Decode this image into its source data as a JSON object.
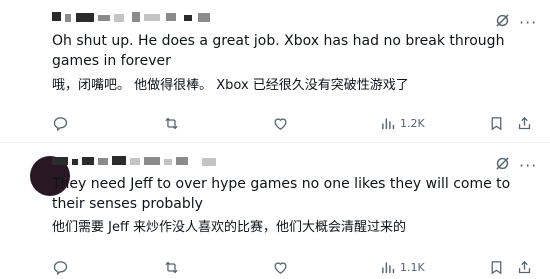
{
  "tweets": [
    {
      "text": "Oh shut up.  He does a great job.  Xbox has had no break through games in forever",
      "translation": "哦，闭嘴吧。 他做得很棒。 Xbox 已经很久没有突破性游戏了",
      "views": "1.2K"
    },
    {
      "text": "They need Jeff to over hype games no one likes they will come to their senses probably",
      "translation": "他们需要 Jeff 来炒作没人喜欢的比赛，他们大概会清醒过来的",
      "views": "1.1K"
    }
  ],
  "icons": {
    "grok": "grok-icon",
    "more": "more-icon",
    "reply": "reply-icon",
    "retweet": "retweet-icon",
    "like": "like-icon",
    "views": "views-icon",
    "bookmark": "bookmark-icon",
    "share": "share-icon"
  },
  "colors": {
    "text": "#0f1419",
    "muted": "#536471",
    "divider": "#eff3f4"
  }
}
